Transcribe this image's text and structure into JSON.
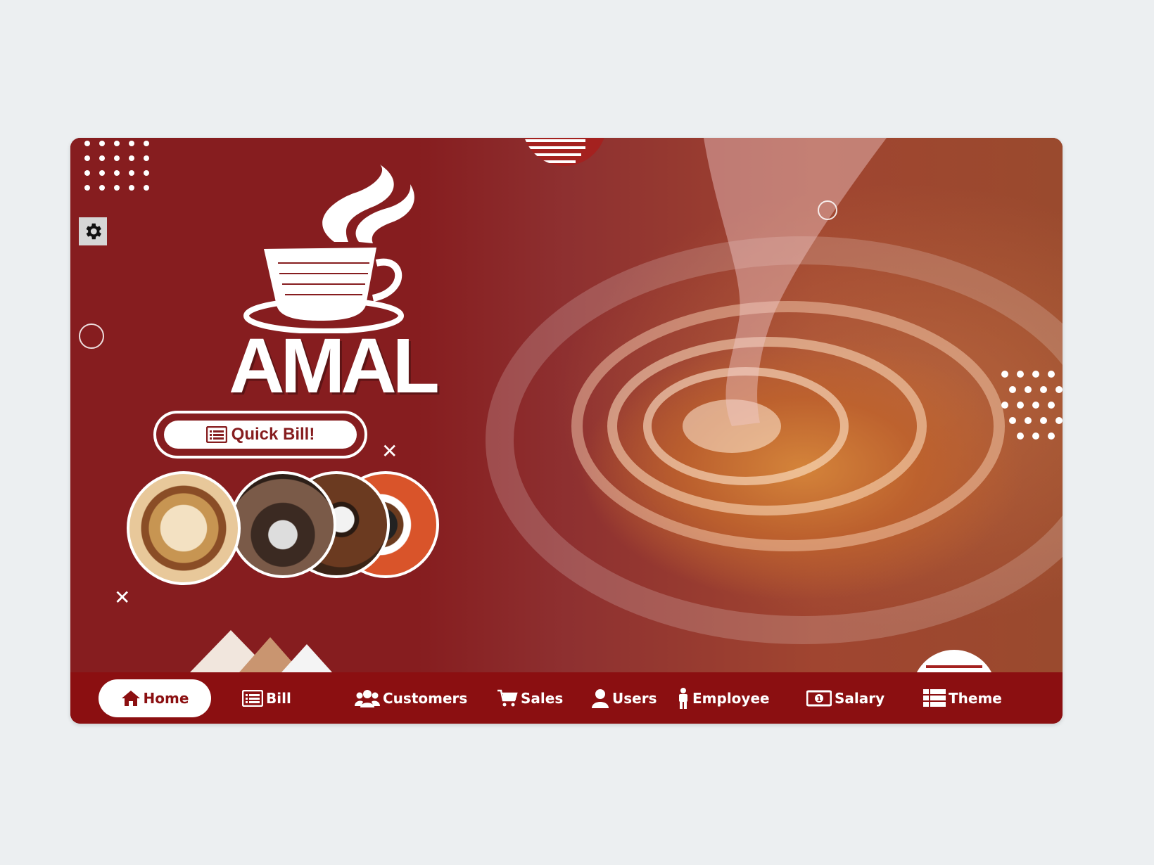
{
  "brand": {
    "name": "AMAL"
  },
  "quick_bill": {
    "label": "Quick Bill!"
  },
  "settings": {
    "icon": "gear-icon"
  },
  "nav": {
    "items": [
      {
        "label": "Home",
        "icon": "home-icon",
        "active": true
      },
      {
        "label": "Bill",
        "icon": "list-icon",
        "active": false
      },
      {
        "label": "Customers",
        "icon": "users-group-icon",
        "active": false
      },
      {
        "label": "Sales",
        "icon": "cart-icon",
        "active": false
      },
      {
        "label": "Users",
        "icon": "user-icon",
        "active": false
      },
      {
        "label": "Employee",
        "icon": "person-icon",
        "active": false
      },
      {
        "label": "Salary",
        "icon": "money-icon",
        "active": false
      },
      {
        "label": "Theme",
        "icon": "theme-list-icon",
        "active": false
      }
    ]
  },
  "colors": {
    "primary": "#861d1f",
    "navbar": "#8b0f11",
    "accent_orange": "#d6863a",
    "page_bg": "#eceff1"
  }
}
